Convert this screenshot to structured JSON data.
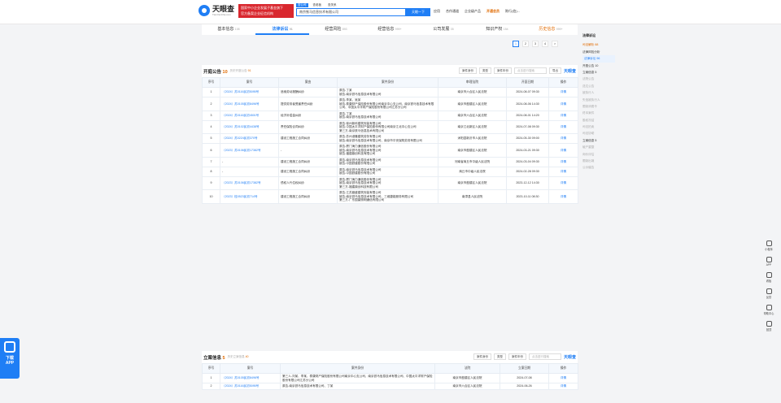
{
  "header": {
    "logo_text": "天眼查",
    "logo_sub": "TianYanCha.com",
    "ad_line1": "国家中小企业发展子基金旗下",
    "ad_line2": "官方备案企业征信机构",
    "search_tabs": [
      "查公司",
      "查老板",
      "查关系"
    ],
    "search_value": "南京铁马信息技术有限公司",
    "search_button": "天眼一下",
    "nav": [
      "应用",
      "合作通道",
      "企业级产品",
      "开通会员",
      "陈行(伯)..."
    ]
  },
  "tabs": [
    {
      "label": "基本信息",
      "count": "108"
    },
    {
      "label": "法律诉讼",
      "count": "91"
    },
    {
      "label": "经营风险",
      "count": "893"
    },
    {
      "label": "经营信息",
      "count": "999+"
    },
    {
      "label": "公司发展",
      "count": "35"
    },
    {
      "label": "知识产权",
      "count": "154"
    },
    {
      "label": "历史信息",
      "count": "999+"
    }
  ],
  "pager": [
    "1",
    "2",
    "3",
    "4",
    ">"
  ],
  "sidebar": {
    "title": "法律诉讼",
    "items": [
      {
        "label": "司法解析 88",
        "state": "red"
      },
      {
        "label": "法律风险分析",
        "state": "dark"
      },
      {
        "label": "法律诉讼 96",
        "state": "active"
      },
      {
        "label": "开庭公告 10",
        "state": "dark"
      },
      {
        "label": "立案信息 5",
        "state": "dark"
      },
      {
        "label": "法院公告",
        "state": "muted"
      },
      {
        "label": "送达公告",
        "state": "muted"
      },
      {
        "label": "被执行人",
        "state": "muted"
      },
      {
        "label": "失信被执行人",
        "state": "muted"
      },
      {
        "label": "限制消费令",
        "state": "muted"
      },
      {
        "label": "终本案件",
        "state": "muted"
      },
      {
        "label": "股权冻结",
        "state": "muted"
      },
      {
        "label": "司法拍卖",
        "state": "muted"
      },
      {
        "label": "司法协助",
        "state": "muted"
      },
      {
        "label": "立案信息 5",
        "state": "dark"
      },
      {
        "label": "破产重整",
        "state": "muted"
      },
      {
        "label": "询价评估",
        "state": "muted"
      },
      {
        "label": "限制出境",
        "state": "muted"
      },
      {
        "label": "公示催告",
        "state": "muted"
      }
    ]
  },
  "hearings": {
    "title": "开庭公告",
    "count": "10",
    "note_prefix": "历史开庭公告",
    "note_count": "91",
    "tools": [
      "案件身份",
      "类型",
      "案件年份"
    ],
    "search_placeholder": "点击进行搜索",
    "export": "导出",
    "brand": "天眼查",
    "columns": [
      "序号",
      "案号",
      "案由",
      "案件身份",
      "审理法院",
      "开庭日期",
      "操作"
    ],
    "rows": [
      {
        "no": "1",
        "case": "（2024）苏0116民初5095号",
        "cause": "追索劳动报酬纠纷",
        "parties": [
          "原告-丁某",
          "被告-南京铁马信息技术有限公司"
        ],
        "court": "南京市六合区人民法院",
        "date": "2024-08-07 09:30",
        "op": "详情"
      },
      {
        "no": "2",
        "case": "（2024）苏0105民初8496号",
        "cause": "提供劳务者受害责任纠纷",
        "parties": [
          "原告-李某、吴某",
          "被告-泰康财产保险股份有限公司南京中心支公司、南京铁马信息技术有限公司、中国太平洋财产保险股份有限公司江苏分公司"
        ],
        "court": "南京市鼓楼区人民法院",
        "date": "2024-08-06 14:30",
        "op": "详情"
      },
      {
        "no": "3",
        "case": "（2024）苏0116民初4501号",
        "cause": "经济补偿金纠纷",
        "parties": [
          "原告-丁某",
          "被告-南京铁马信息技术有限公司"
        ],
        "court": "南京市六合区人民法院",
        "date": "2024-08-01 14:20",
        "op": "详情"
      },
      {
        "no": "4",
        "case": "（2024）苏0102民初4438号",
        "cause": "责任保险合同纠纷",
        "parties": [
          "原告-徐州新科建筑安装有限公司",
          "被告-中国太平洋财产保险股份有限公司南京江北中心支公司",
          "第三方-南京铁马信息技术有限公司"
        ],
        "court": "南京江北新区人民法院",
        "date": "2024-07-08 09:30",
        "op": "详情"
      },
      {
        "no": "5",
        "case": "（2024）苏0224民初370号",
        "cause": "建设工程施工合同纠纷",
        "parties": [
          "原告-苏州淑隆建筑劳务有限公司",
          "被告-南京铁马信息技术有限公司、南京市平安保筑劳务有限公司"
        ],
        "court": "沭阳县新沂市人民法院",
        "date": "2024-05-30 09:00",
        "op": "详情"
      },
      {
        "no": "6",
        "case": "（2023）苏0106民初17382号",
        "cause": "-",
        "parties": [
          "原告-厦门海力通信股份有限公司",
          "被告-南京铁马信息技术有限公司",
          "被告-福建鼎创科技有限公司"
        ],
        "court": "南京市鼓楼区人民法院",
        "date": "2024-03-21 09:30",
        "op": "详情"
      },
      {
        "no": "7",
        "case": "-",
        "cause": "建设工程施工合同纠纷",
        "parties": [
          "原告-南京铁马信息技术有限公司",
          "被告-中国铁建股份有限公司"
        ],
        "court": "河南省商丘市中级人民法院",
        "date": "2024-03-04 09:30",
        "op": "详情"
      },
      {
        "no": "8",
        "case": "-",
        "cause": "建设工程施工合同纠纷",
        "parties": [
          "原告-南京铁马信息技术有限公司",
          "被告-中国铁建股份有限公司"
        ],
        "court": "商丘市中级人民法院",
        "date": "2024-02-28 09:30",
        "op": "详情"
      },
      {
        "no": "9",
        "case": "（2023）苏0106民初17382号",
        "cause": "债权人代位权纠纷",
        "parties": [
          "原告-厦门海力通信股份有限公司",
          "被告-南京铁马信息技术有限公司",
          "第三方-福建鼎创科技有限公司"
        ],
        "court": "南京市鼓楼区人民法院",
        "date": "2023-12-12 14:30",
        "op": "详情"
      },
      {
        "no": "10",
        "case": "（2023）桂0523民初714号",
        "cause": "建设工程施工合同纠纷",
        "parties": [
          "原告-江苏鼎盛建筑安装有限公司",
          "被告-南京铁马信息技术有限公司、三维捷能服务有限公司",
          "第三方-广东国豪照明通信有限公司"
        ],
        "court": "南漳县人民法院",
        "date": "2023-10-11 08:30",
        "op": "详情"
      }
    ]
  },
  "filings": {
    "title": "立案信息",
    "count": "5",
    "note_prefix": "历史立案信息",
    "note_count": "40",
    "tools": [
      "案件身份",
      "类型",
      "案件年份"
    ],
    "search_placeholder": "点击进行搜索",
    "brand": "天眼查",
    "columns": [
      "序号",
      "案号",
      "案件身份",
      "法院",
      "立案日期",
      "操作"
    ],
    "rows": [
      {
        "no": "1",
        "case": "（2024）苏0105民初8496号",
        "parties": "第三人-刘某、李某、泰康财产保险股份有限公司南京中心支公司、南京铁马信息技术有限公司、中国太平洋财产保险股份有限公司江苏分公司",
        "court": "南京市鼓楼区人民法院",
        "date": "2024-07-08",
        "op": "详情"
      },
      {
        "no": "2",
        "case": "（2024）苏0116民初5095号",
        "parties": "原告-南京铁马信息技术有限公司、丁某",
        "court": "南京市六合区人民法院",
        "date": "2024-06-26",
        "op": "详情"
      }
    ]
  },
  "rail": [
    "小程序",
    "APP",
    "看板",
    "反馈",
    "帮助中心",
    "回顶"
  ],
  "app_badge": {
    "line1": "下载",
    "line2": "APP"
  }
}
